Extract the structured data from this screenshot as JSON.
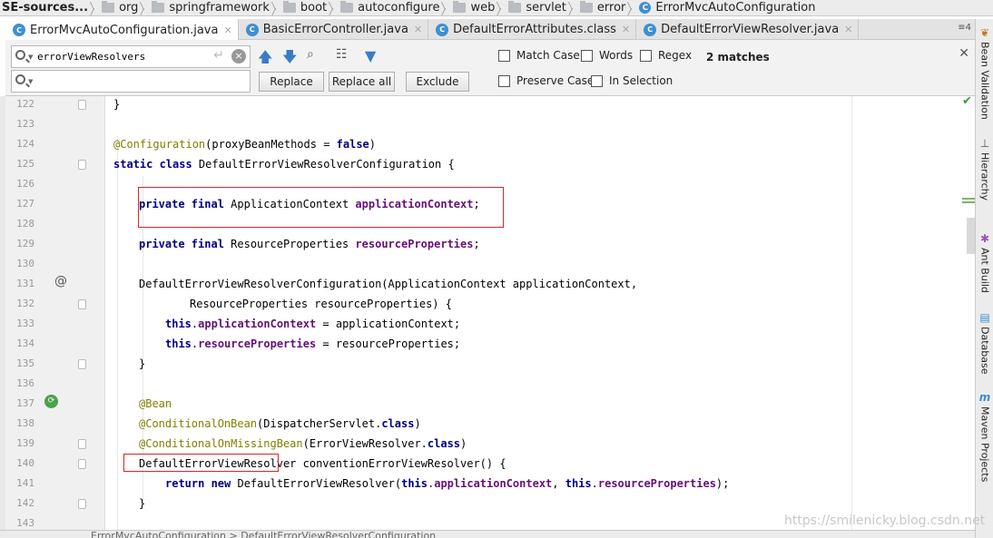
{
  "breadcrumb": [
    "SE-sources...",
    "org",
    "springframework",
    "boot",
    "autoconfigure",
    "web",
    "servlet",
    "error",
    "ErrorMvcAutoConfiguration"
  ],
  "tabs": [
    {
      "label": "ErrorMvcAutoConfiguration.java",
      "icon": "class-icon"
    },
    {
      "label": "BasicErrorController.java",
      "icon": "class-icon"
    },
    {
      "label": "DefaultErrorAttributes.class",
      "icon": "class-icon"
    },
    {
      "label": "DefaultErrorViewResolver.java",
      "icon": "class-icon"
    }
  ],
  "tab_count": "4",
  "find": {
    "search_value": "errorViewResolvers",
    "replace_value": "",
    "replace_label": "Replace",
    "replace_all_label": "Replace all",
    "exclude_label": "Exclude",
    "match_case_label": "Match Case",
    "words_label": "Words",
    "regex_label": "Regex",
    "preserve_case_label": "Preserve Case",
    "in_selection_label": "In Selection",
    "matches": "2 matches"
  },
  "line_numbers": [
    "122",
    "123",
    "124",
    "125",
    "126",
    "127",
    "128",
    "129",
    "130",
    "131",
    "132",
    "133",
    "134",
    "135",
    "136",
    "137",
    "138",
    "139",
    "140",
    "141",
    "142",
    "143"
  ],
  "sidebar_tools": [
    "Bean Validation",
    "Hierarchy",
    "Ant Build",
    "Database",
    "Maven Projects"
  ],
  "status_text": "ErrorMvcAutoConfiguration > DefaultErrorViewResolverConfiguration",
  "watermark": "https://smilenicky.blog.csdn.net",
  "colors": {
    "keyword": "#000080",
    "annotation": "#808000",
    "field": "#660e7a",
    "highlight": "#d8232a"
  }
}
